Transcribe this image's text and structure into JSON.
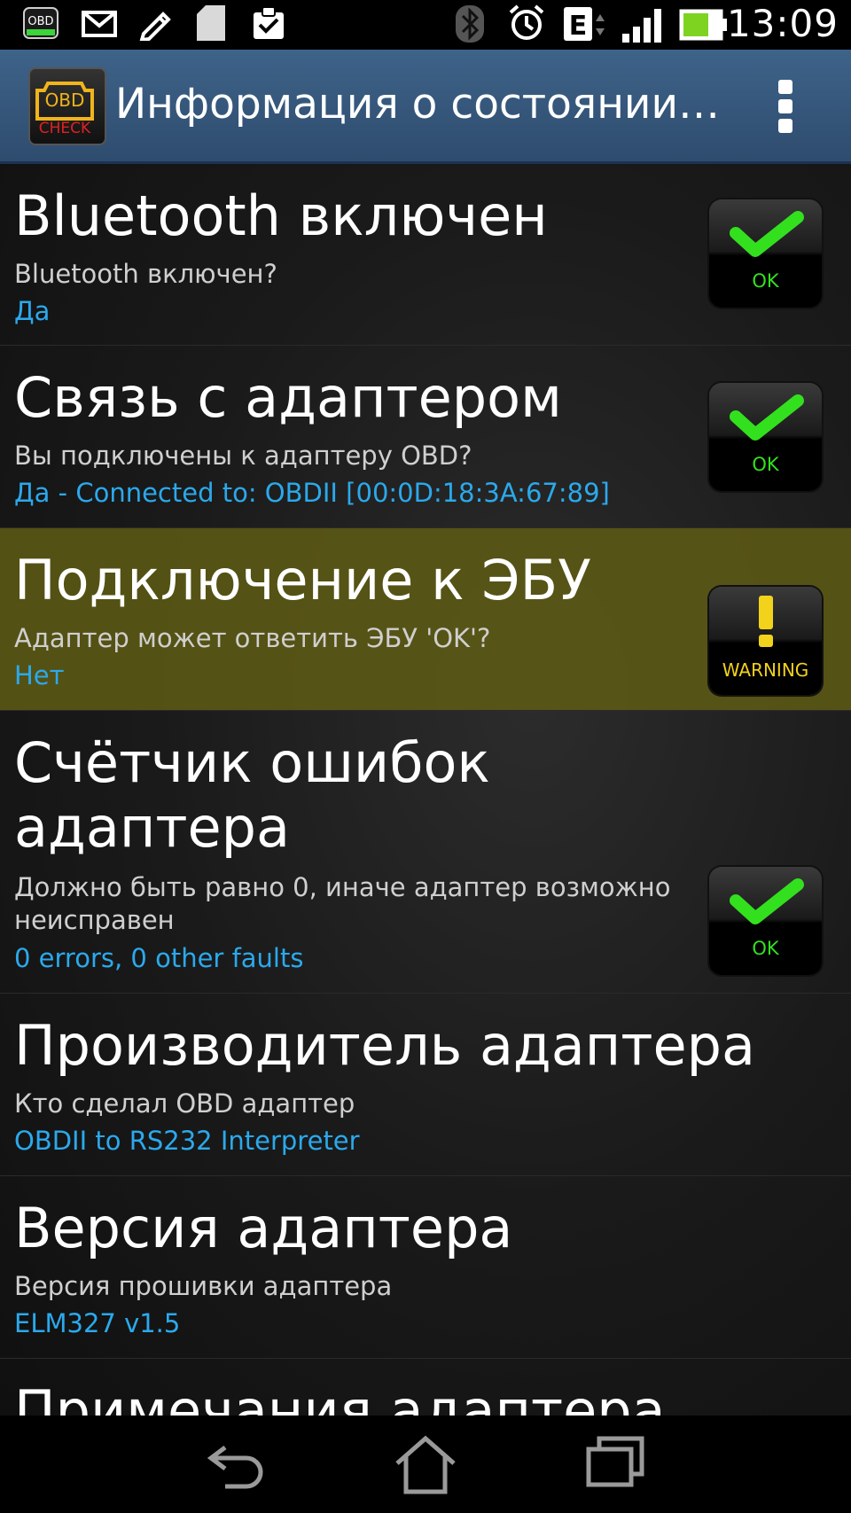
{
  "status_bar": {
    "time": "13:09",
    "left_icons": [
      "obd-notification-icon",
      "mail-icon",
      "pencil-icon",
      "sd-card-icon",
      "clipboard-check-icon"
    ],
    "right_icons": [
      "bluetooth-icon",
      "alarm-icon",
      "edge-network-icon",
      "signal-icon",
      "battery-icon"
    ],
    "network_label": "E"
  },
  "action_bar": {
    "title": "Информация о состоянии…",
    "logo_text_top": "OBD",
    "logo_text_bottom": "CHECK"
  },
  "items": [
    {
      "title": "Bluetooth включен",
      "subtitle": "Bluetooth включен?",
      "value": "Да",
      "status": "OK"
    },
    {
      "title": "Связь с адаптером",
      "subtitle": "Вы подключены к адаптеру OBD?",
      "value": "Да - Connected to: OBDII [00:0D:18:3A:67:89]",
      "status": "OK"
    },
    {
      "title": "Подключение к ЭБУ",
      "subtitle": "Адаптер может ответить ЭБУ 'OK'?",
      "value": "Нет",
      "status": "WARNING"
    },
    {
      "title_line1": "Счётчик ошибок",
      "title_line2": "адаптера",
      "subtitle_line1": "Должно быть равно 0, иначе адаптер возможно",
      "subtitle_line2": "неисправен",
      "value": "0 errors, 0 other faults",
      "status": "OK"
    },
    {
      "title": "Производитель адаптера",
      "subtitle": "Кто сделал OBD адаптер",
      "value": "OBDII to RS232 Interpreter"
    },
    {
      "title": "Версия адаптера",
      "subtitle": "Версия прошивки адаптера",
      "value": "ELM327 v1.5"
    },
    {
      "title": "Примечания адаптера"
    }
  ],
  "colors": {
    "action_bar": "#35587d",
    "value_text": "#2ba9ec",
    "warning_row": "#5f5c14",
    "ok_check": "#33e01e",
    "warning_text": "#f2d21a"
  }
}
